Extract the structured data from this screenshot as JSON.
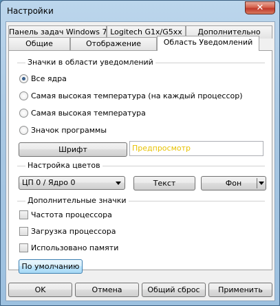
{
  "window": {
    "title": "Настройки",
    "close_label": "✕"
  },
  "tabs": {
    "row1": [
      {
        "label": "Панель задач Windows 7"
      },
      {
        "label": "Logitech G1x/G5xx"
      },
      {
        "label": "Дополнительно"
      }
    ],
    "row2": [
      {
        "label": "Общие"
      },
      {
        "label": "Отображение"
      },
      {
        "label": "Область Уведомлений",
        "active": true
      }
    ]
  },
  "notification_icons": {
    "group_label": "Значки в области уведомлений",
    "options": [
      {
        "label": "Все ядра",
        "checked": true
      },
      {
        "label": "Самая высокая температура (на каждый процессор)",
        "checked": false
      },
      {
        "label": "Самая высокая температура",
        "checked": false
      },
      {
        "label": "Значок программы",
        "checked": false
      }
    ],
    "font_button": "Шрифт",
    "preview_text": "Предпросмотр",
    "preview_color": "#e8c200"
  },
  "colors": {
    "group_label": "Настройка цветов",
    "core_select": "ЦП 0 / Ядро 0",
    "text_button": "Текст",
    "background_button": "Фон"
  },
  "extra_icons": {
    "group_label": "Дополнительные значки",
    "options": [
      {
        "label": "Частота процессора",
        "checked": false
      },
      {
        "label": "Загрузка процессора",
        "checked": false
      },
      {
        "label": "Использовано памяти",
        "checked": false
      }
    ],
    "defaults_button": "По умолчанию"
  },
  "footer": {
    "ok": "OK",
    "cancel": "Отмена",
    "reset_all": "Общий сброс",
    "apply": "Применить"
  }
}
